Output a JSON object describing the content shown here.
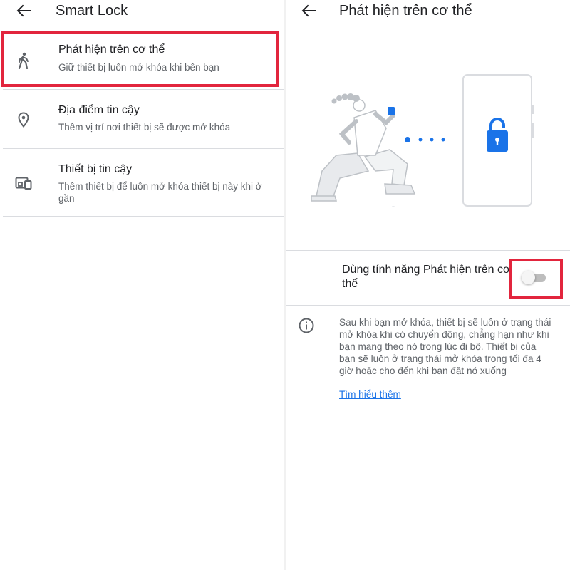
{
  "left": {
    "title": "Smart Lock",
    "items": [
      {
        "title": "Phát hiện trên cơ thể",
        "subtitle": "Giữ thiết bị luôn mở khóa khi bên bạn",
        "icon": "walking-person-icon"
      },
      {
        "title": "Địa điểm tin cậy",
        "subtitle": "Thêm vị trí nơi thiết bị sẽ được mở khóa",
        "icon": "location-pin-icon"
      },
      {
        "title": "Thiết bị tin cậy",
        "subtitle": "Thêm thiết bị để luôn mở khóa thiết bị này khi ở gần",
        "icon": "devices-icon"
      }
    ]
  },
  "right": {
    "title": "Phát hiện trên cơ thể",
    "toggle": {
      "label": "Dùng tính năng Phát hiện trên cơ thể",
      "state": "off"
    },
    "info": "Sau khi bạn mở khóa, thiết bị sẽ luôn ở trạng thái mở khóa khi có chuyển động, chẳng hạn như khi bạn mang theo nó trong lúc đi bộ. Thiết bị của bạn sẽ luôn ở trạng thái mở khóa trong tối đa 4 giờ hoặc cho đến khi bạn đặt nó xuống",
    "learn_more": "Tìm hiểu thêm"
  },
  "colors": {
    "highlight": "#e2253d",
    "accent": "#1a73e8",
    "lock_blue": "#1a73e8"
  }
}
